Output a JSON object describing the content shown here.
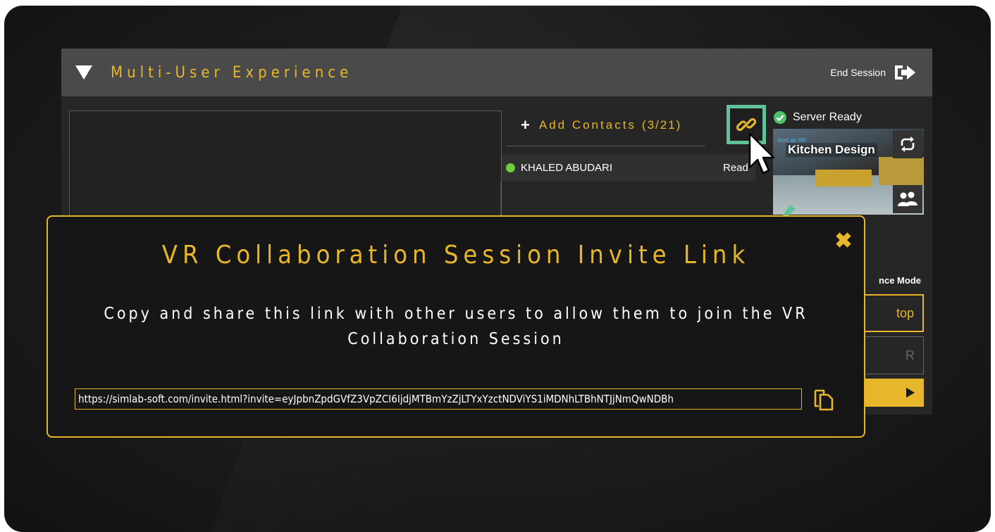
{
  "panel": {
    "title": "Multi-User Experience",
    "end_session_label": "End Session"
  },
  "contacts": {
    "add_label": "Add Contacts",
    "count": "(3/21)",
    "items": [
      {
        "name": "KHALED ABUDARI",
        "status": "Read",
        "online": true
      }
    ]
  },
  "server": {
    "status": "Server Ready",
    "project_caption": "SimLab VR",
    "project_name": "Kitchen Design"
  },
  "experience": {
    "label": "nce Mode",
    "option_1": "top",
    "option_2": "R"
  },
  "modal": {
    "title": "VR Collaboration Session Invite Link",
    "message": "Copy and share this link with other users to allow them to join the VR Collaboration Session",
    "link": "https://simlab-soft.com/invite.html?invite=eyJpbnZpdGVfZ3VpZCI6IjdjMTBmYzZjLTYxYzctNDViYS1iMDNhLTBhNTJjNmQwNDBh"
  },
  "colors": {
    "accent": "#e8b62a",
    "highlight": "#5fc39a",
    "online": "#6fcc3a"
  },
  "icons": [
    "triangle-down-icon",
    "exit-icon",
    "plus-icon",
    "link-icon",
    "check-circle-icon",
    "sync-icon",
    "users-icon",
    "close-icon",
    "copy-icon",
    "cursor-icon",
    "arrow-icon",
    "play-icon"
  ]
}
